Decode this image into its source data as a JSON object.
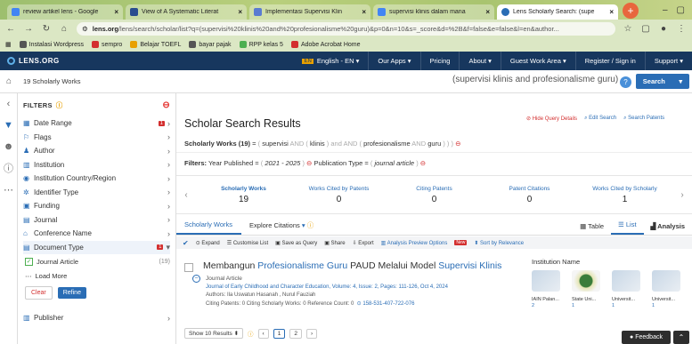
{
  "browser": {
    "tabs": [
      {
        "title": "review artikel lens - Google",
        "color": "#4285f4",
        "active": false
      },
      {
        "title": "View of A Systematic Literat",
        "color": "#2a4d8f",
        "active": false
      },
      {
        "title": "Implementasi Supervisi Klin",
        "color": "#5a7bd1",
        "active": false
      },
      {
        "title": "supervisi klinis dalam mana",
        "color": "#4285f4",
        "active": false
      },
      {
        "title": "Lens Scholarly Search: (supe",
        "color": "#2a6db5",
        "active": true
      }
    ],
    "url_host": "lens.org",
    "url_rest": "/lens/search/scholar/list?q=(supervisi%20klinis%20and%20profesionalisme%20guru)&p=0&n=10&s=_score&d=%2B&f=false&e=false&l=en&author..."
  },
  "bookmarks": [
    {
      "label": "Instalasi Wordpress",
      "color": "#555555"
    },
    {
      "label": "sempro",
      "color": "#d32f2f"
    },
    {
      "label": "Belajar TOEFL",
      "color": "#e8a000"
    },
    {
      "label": "bayar pajak",
      "color": "#555555"
    },
    {
      "label": "RPP kelas 5",
      "color": "#4caf50"
    },
    {
      "label": "Adobe Acrobat Home",
      "color": "#d32f2f"
    }
  ],
  "lens": {
    "logo": "LENS.ORG",
    "nav": [
      "English - EN",
      "Our Apps",
      "Pricing",
      "About",
      "Guest Work Area",
      "Register / Sign in",
      "Support"
    ],
    "count": "19 Scholarly Works",
    "query": "(supervisi klinis and profesionalisme guru)",
    "search_label": "Search"
  },
  "filters": {
    "title": "FILTERS",
    "items": [
      {
        "label": "Date Range",
        "icon": "calendar-icon",
        "tag": "1"
      },
      {
        "label": "Flags",
        "icon": "flag-icon",
        "tag": ""
      },
      {
        "label": "Author",
        "icon": "person-icon",
        "tag": ""
      },
      {
        "label": "Institution",
        "icon": "building-icon",
        "tag": ""
      },
      {
        "label": "Institution Country/Region",
        "icon": "globe-icon",
        "tag": ""
      },
      {
        "label": "Identifier Type",
        "icon": "id-icon",
        "tag": ""
      },
      {
        "label": "Funding",
        "icon": "funding-icon",
        "tag": ""
      },
      {
        "label": "Journal",
        "icon": "journal-icon",
        "tag": ""
      },
      {
        "label": "Conference Name",
        "icon": "conference-icon",
        "tag": ""
      },
      {
        "label": "Document Type",
        "icon": "document-icon",
        "tag": "1"
      }
    ],
    "doc_type_option": "Journal Article",
    "doc_type_count": "(19)",
    "load_more": "Load More",
    "clear": "Clear",
    "refine": "Refine",
    "publisher": "Publisher"
  },
  "main": {
    "title": "Scholar Search Results",
    "hide_query": "Hide Query Details",
    "edit_search": "Edit Search",
    "search_patents": "Search Patents",
    "qline_label": "Scholarly Works (19)",
    "qline_terms": [
      "supervisi",
      "klinis",
      "profesionalisme",
      "guru"
    ],
    "filters_label": "Filters:",
    "filter_year_label": "Year Published",
    "filter_year_value": "2021 - 2025",
    "filter_pub_label": "Publication Type",
    "filter_pub_value": "journal article",
    "stats": [
      {
        "label": "Scholarly Works",
        "value": "19"
      },
      {
        "label": "Works Cited by Patents",
        "value": "0"
      },
      {
        "label": "Citing Patents",
        "value": "0"
      },
      {
        "label": "Patent Citations",
        "value": "0"
      },
      {
        "label": "Works Cited by Scholarly",
        "value": "1"
      }
    ],
    "tab_scholarly": "Scholarly Works",
    "tab_explore": "Explore Citations",
    "tab_table": "Table",
    "tab_list": "List",
    "tab_analysis": "Analysis",
    "toolbar": [
      "Expand",
      "Customise List",
      "Save as Query",
      "Share",
      "Export",
      "Analysis Preview Options"
    ],
    "toolbar_new": "New",
    "sort": "Sort by Relevance",
    "result": {
      "title_1": "Membangun ",
      "title_2": "Profesionalisme Guru",
      "title_3": " PAUD Melalui Model ",
      "title_4": "Supervisi Klinis",
      "type": "Journal Article",
      "journal": "Journal of Early Childhood and Character Education, Volume: 4, Issue: 2, Pages: 111-126, Oct 4, 2024",
      "authors": "Authors: Ila Uswatun Hasanah , Nurul Fauziah",
      "citing": "Citing Patents: 0    Citing Scholarly Works: 0    Reference Count: 0",
      "id": "158-531-407-722-076"
    },
    "institution_title": "Institution Name",
    "institutions": [
      {
        "name": "IAIN Palan...",
        "count": "2"
      },
      {
        "name": "State Uni...",
        "count": "1"
      },
      {
        "name": "Universit...",
        "count": "1"
      },
      {
        "name": "Universit...",
        "count": "1"
      }
    ],
    "pager_show": "Show 10 Results",
    "pager_pages": [
      "1",
      "2"
    ],
    "feedback": "Feedback"
  }
}
